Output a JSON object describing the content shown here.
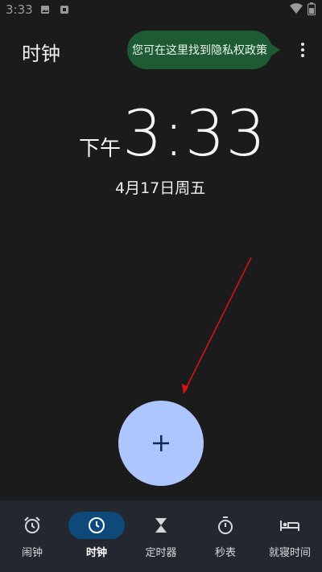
{
  "status_bar": {
    "time": "3:33",
    "icons": [
      "image-icon",
      "app-notification-icon",
      "wifi-icon",
      "battery-icon"
    ]
  },
  "header": {
    "title": "时钟",
    "tooltip": "您可在这里找到隐私权政策",
    "more_icon": "more-vert-icon"
  },
  "clock": {
    "ampm": "下午",
    "time": "3:33",
    "date": "4月17日周五"
  },
  "fab": {
    "icon": "add-icon"
  },
  "nav": {
    "items": [
      {
        "label": "闹钟",
        "icon": "alarm-icon",
        "active": false
      },
      {
        "label": "时钟",
        "icon": "clock-icon",
        "active": true
      },
      {
        "label": "定时器",
        "icon": "hourglass-icon",
        "active": false
      },
      {
        "label": "秒表",
        "icon": "stopwatch-icon",
        "active": false
      },
      {
        "label": "就寝时间",
        "icon": "bed-icon",
        "active": false
      }
    ]
  },
  "colors": {
    "background": "#1b1b1b",
    "tooltip": "#1e5b34",
    "fab": "#adc6ff",
    "nav_background": "#232730",
    "nav_active": "#0e4a79",
    "annotation_arrow": "#e01010"
  }
}
